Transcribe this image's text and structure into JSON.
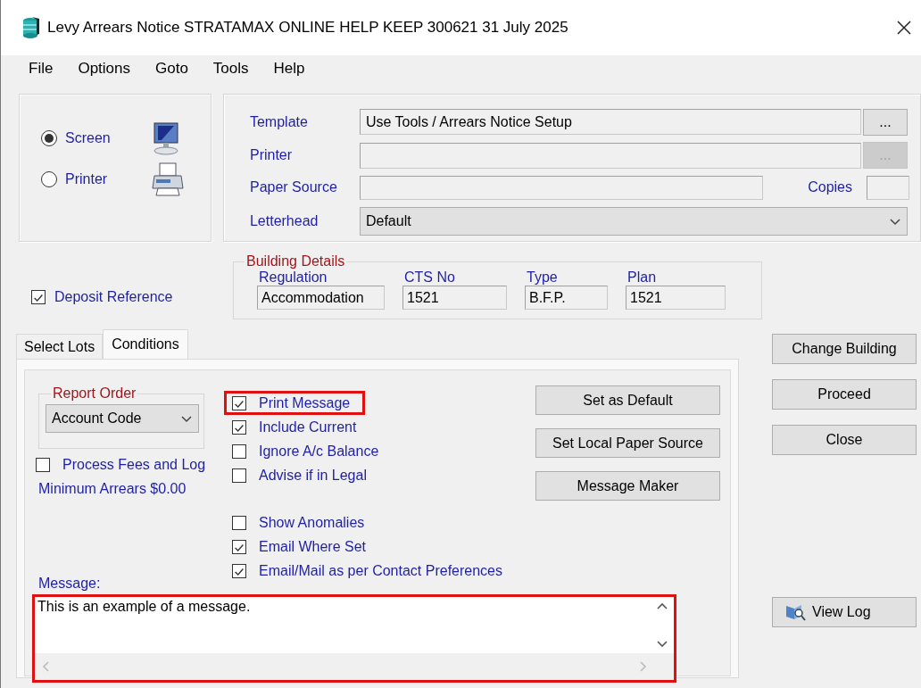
{
  "window": {
    "title": "Levy Arrears Notice STRATAMAX ONLINE HELP KEEP 300621 31 July 2025"
  },
  "menu": [
    "File",
    "Options",
    "Goto",
    "Tools",
    "Help"
  ],
  "output": [
    {
      "label": "Screen",
      "selected": true,
      "kind": "screen"
    },
    {
      "label": "Printer",
      "selected": false,
      "kind": "printer"
    }
  ],
  "print_settings": {
    "template": {
      "label": "Template",
      "value": "Use Tools / Arrears Notice Setup",
      "button": "...",
      "disabled": false
    },
    "printer": {
      "label": "Printer",
      "button": "...",
      "disabled": true
    },
    "paper_source": {
      "label": "Paper Source"
    },
    "copies": {
      "label": "Copies"
    },
    "letterhead": {
      "label": "Letterhead",
      "value": "Default"
    }
  },
  "deposit_reference": {
    "label": "Deposit Reference",
    "checked": true
  },
  "building_details": {
    "title": "Building Details",
    "fields": [
      {
        "label": "Regulation",
        "value": "Accommodation"
      },
      {
        "label": "CTS No",
        "value": "1521"
      },
      {
        "label": "Type",
        "value": "B.F.P."
      },
      {
        "label": "Plan",
        "value": "1521"
      }
    ]
  },
  "tabs": [
    {
      "label": "Select Lots",
      "selected": false
    },
    {
      "label": "Conditions",
      "selected": true
    }
  ],
  "report_order": {
    "title": "Report Order",
    "value": "Account Code"
  },
  "process_fees": {
    "label": "Process Fees and Log",
    "checked": false
  },
  "minimum_arrears": "Minimum Arrears $0.00",
  "option_groups": [
    [
      {
        "label": "Print Message",
        "checked": true,
        "highlighted": true
      },
      {
        "label": "Include Current",
        "checked": true,
        "highlighted": false
      },
      {
        "label": "Ignore A/c Balance",
        "checked": false,
        "highlighted": false
      },
      {
        "label": "Advise if in Legal",
        "checked": false,
        "highlighted": false
      }
    ],
    [
      {
        "label": "Show Anomalies",
        "checked": false,
        "highlighted": false
      },
      {
        "label": "Email Where Set",
        "checked": true,
        "highlighted": false
      },
      {
        "label": "Email/Mail as per Contact Preferences",
        "checked": true,
        "highlighted": false
      }
    ]
  ],
  "condition_buttons": [
    "Set as Default",
    "Set Local Paper Source",
    "Message Maker"
  ],
  "message": {
    "label": "Message:",
    "value": "This is an example of a message.",
    "highlighted": true
  },
  "actions": [
    "Change Building",
    "Proceed",
    "Close"
  ],
  "view_log": "View Log"
}
